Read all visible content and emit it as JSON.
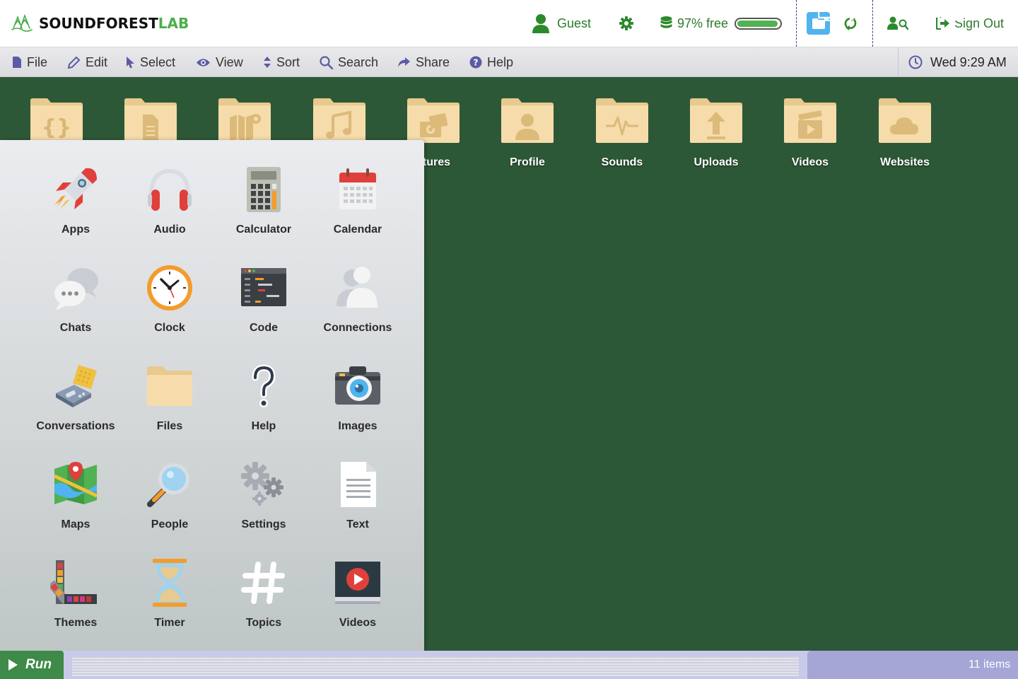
{
  "header": {
    "logo": {
      "part1": "SOUNDFOREST",
      "part2": "LAB"
    },
    "guest_label": "Guest",
    "storage_label": "97% free",
    "storage_fraction": 0.97,
    "signout_label": "Sign Out"
  },
  "menu": {
    "items": [
      {
        "label": "File",
        "icon": "file-icon"
      },
      {
        "label": "Edit",
        "icon": "pencil-icon"
      },
      {
        "label": "Select",
        "icon": "cursor-icon"
      },
      {
        "label": "View",
        "icon": "eye-icon"
      },
      {
        "label": "Sort",
        "icon": "sort-icon"
      },
      {
        "label": "Search",
        "icon": "search-icon"
      },
      {
        "label": "Share",
        "icon": "share-icon"
      },
      {
        "label": "Help",
        "icon": "help-icon"
      }
    ],
    "clock": "Wed 9:29 AM"
  },
  "desktop": {
    "folders": [
      {
        "label": "",
        "icon": "code-folder-icon"
      },
      {
        "label": "",
        "icon": "document-folder-icon"
      },
      {
        "label": "",
        "icon": "map-folder-icon"
      },
      {
        "label": "",
        "icon": "music-folder-icon"
      },
      {
        "label": "ctures",
        "icon": "pictures-folder-icon"
      },
      {
        "label": "Profile",
        "icon": "profile-folder-icon"
      },
      {
        "label": "Sounds",
        "icon": "sounds-folder-icon"
      },
      {
        "label": "Uploads",
        "icon": "uploads-folder-icon"
      },
      {
        "label": "Videos",
        "icon": "videos-folder-icon"
      },
      {
        "label": "Websites",
        "icon": "websites-folder-icon"
      }
    ]
  },
  "apps": {
    "items": [
      {
        "label": "Apps",
        "icon": "rocket-icon"
      },
      {
        "label": "Audio",
        "icon": "headphones-icon"
      },
      {
        "label": "Calculator",
        "icon": "calculator-icon"
      },
      {
        "label": "Calendar",
        "icon": "calendar-icon"
      },
      {
        "label": "Chats",
        "icon": "chat-bubbles-icon"
      },
      {
        "label": "Clock",
        "icon": "clock-icon"
      },
      {
        "label": "Code",
        "icon": "code-editor-icon"
      },
      {
        "label": "Connections",
        "icon": "connections-icon"
      },
      {
        "label": "Conversations",
        "icon": "communicator-icon"
      },
      {
        "label": "Files",
        "icon": "folder-icon"
      },
      {
        "label": "Help",
        "icon": "question-mark-icon"
      },
      {
        "label": "Images",
        "icon": "camera-icon"
      },
      {
        "label": "Maps",
        "icon": "map-icon"
      },
      {
        "label": "People",
        "icon": "magnifier-icon"
      },
      {
        "label": "Settings",
        "icon": "gears-icon"
      },
      {
        "label": "Text",
        "icon": "text-document-icon"
      },
      {
        "label": "Themes",
        "icon": "palette-icon"
      },
      {
        "label": "Timer",
        "icon": "hourglass-icon"
      },
      {
        "label": "Topics",
        "icon": "hashtag-icon"
      },
      {
        "label": "Videos",
        "icon": "video-player-icon"
      }
    ]
  },
  "taskbar": {
    "run_label": "Run",
    "item_count": "11 items"
  },
  "colors": {
    "desktop": "#2d5837",
    "brand_green": "#4cae4c",
    "folder": "#f6dcaa",
    "taskbar": "#c9c9ea",
    "run": "#3e8a48"
  }
}
